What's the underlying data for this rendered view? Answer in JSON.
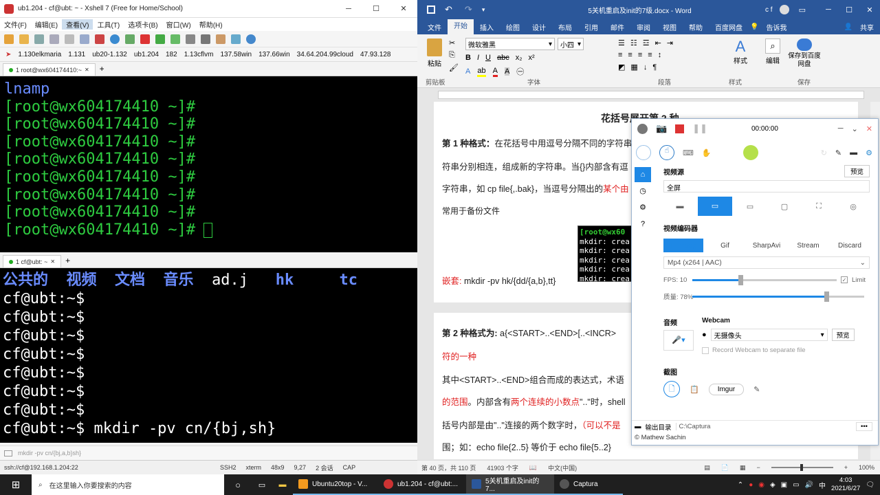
{
  "xshell": {
    "title": "ub1.204 - cf@ubt: ~ - Xshell 7 (Free for Home/School)",
    "menu": [
      "文件(F)",
      "编辑(E)",
      "查看(V)",
      "工具(T)",
      "选项卡(B)",
      "窗口(W)",
      "帮助(H)"
    ],
    "links": [
      "1.130elkmaria",
      "1.131",
      "ub20-1.132",
      "ub1.204",
      "182",
      "1.13cflvm",
      "137.58win",
      "137.66win",
      "34.64.204.99cloud",
      "47.93.128"
    ],
    "tab1": "1 root@wx604174410:~",
    "tab2": "1 cf@ubt: ~",
    "term1": {
      "first": "lnamp",
      "prompt": "[root@wx604174410 ~]#",
      "rows": 8
    },
    "term2": {
      "dirs": [
        "公共的",
        "视频",
        "文档",
        "音乐"
      ],
      "files": [
        "ad.j"
      ],
      "links": [
        "hk",
        "tc"
      ],
      "prompt": "cf@ubt:~$",
      "rows": 7,
      "last_cmd": "mkdir -pv cn/{bj,sh}"
    },
    "input_hint": "mkdir -pv cn/{bj,a,b}sh}",
    "status": {
      "session": "ssh://cf@192.168.1.204:22",
      "proto": "SSH2",
      "term": "xterm",
      "size": "48x9",
      "pos": "9,27",
      "sessions": "2 会话",
      "cap": "CAP"
    }
  },
  "word": {
    "title": "5关机重启及init的7级.docx - Word",
    "user": "c f",
    "tabs": [
      "文件",
      "开始",
      "插入",
      "绘图",
      "设计",
      "布局",
      "引用",
      "邮件",
      "审阅",
      "视图",
      "帮助",
      "百度网盘",
      "告诉我",
      "共享"
    ],
    "active_tab": "开始",
    "font": "微软雅黑",
    "font_size": "小四",
    "groups": [
      "剪贴板",
      "字体",
      "段落",
      "样式",
      "保存"
    ],
    "paste": "粘贴",
    "styles": "样式",
    "edit": "编辑",
    "save_baidu": "保存到百度网盘",
    "heading": "花括号展开第 2 种",
    "p1_bold": "第 1 种格式：",
    "p1": "在花括号中用逗号分隔不同的字符串",
    "p2": "符串分别相连，组成新的字符串。当{}内部含有逗",
    "p3a": "字符串，如 cp file{,.bak}，当逗号分隔出的",
    "p3b": "某个由",
    "p4": "常用于备份文件",
    "nested_label": "嵌套:",
    "nested": "mkdir -pv hk/{dd/{a,b},tt}",
    "code_lines": [
      "[root@wx60",
      "mkdir: crea",
      "mkdir: crea",
      "mkdir: crea",
      "mkdir: crea",
      "mkdir: crea"
    ],
    "p5_bold": "第 2 种格式为:",
    "p5": "a{<START>..<END>[..<INCR>",
    "p6": "符的一种",
    "p7": "其中<START>..<END>组合而成的表达式，术语",
    "p8a": "的范围",
    "p8b": "。内部含有",
    "p8c": "两个连续的小数点",
    "p8d": "\"..\"时，shell",
    "p9a": "括号内部是由\"..\"连接的两个数字时，",
    "p9b": "（可以不是",
    "p10": "围；如：echo file{2..5}  等价于  echo file{5..2}",
    "status": {
      "page": "第 40 页，共 110 页",
      "words": "41903 个字",
      "lang": "中文(中国)",
      "zoom": "100%"
    }
  },
  "captura": {
    "timer": "00:00:00",
    "video_source": "视频源",
    "preview": "预览",
    "source_value": "全屏",
    "encoder_label": "视频编码器",
    "encoders": [
      "FFmpeg",
      "Gif",
      "SharpAvi",
      "Stream",
      "Discard"
    ],
    "codec": "Mp4 (x264 | AAC)",
    "fps": "FPS: 10",
    "limit": "Limit",
    "quality": "质量:  78%",
    "fps_value": 10,
    "quality_value": 78,
    "audio": "音频",
    "webcam": "Webcam",
    "no_camera": "无摄像头",
    "webcam_preview": "预览",
    "record_webcam": "Record Webcam to separate file",
    "screenshot": "截图",
    "imgur": "Imgur",
    "output_label": "输出目录",
    "output_path": "C:\\Captura",
    "credit": "© Mathew Sachin"
  },
  "taskbar": {
    "search": "在这里输入你要搜索的内容",
    "apps": [
      "Ubuntu20top - V...",
      "ub1.204 - cf@ubt:...",
      "5关机重启及init的7...",
      "Captura"
    ],
    "time": "4:03",
    "date": "2021/6/27",
    "ime": "中"
  }
}
